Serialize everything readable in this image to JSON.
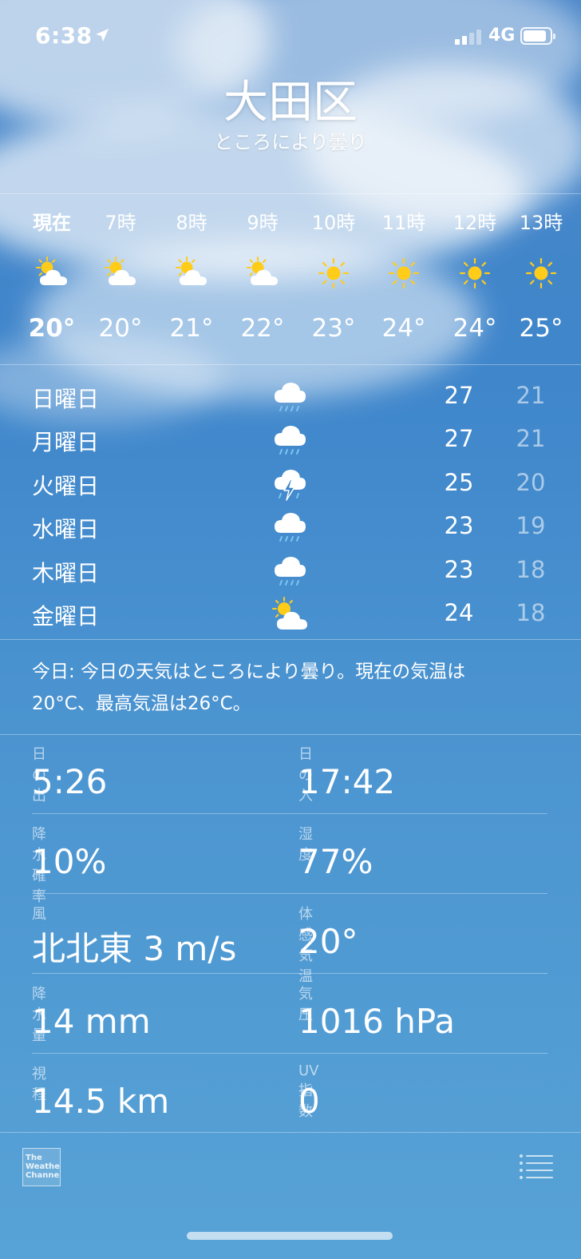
{
  "status_bar": {
    "time": "6:38",
    "network": "4G"
  },
  "header": {
    "city": "大田区",
    "condition": "ところにより曇り"
  },
  "hourly": [
    {
      "label": "現在",
      "icon": "partly-cloudy-icon",
      "temp": "20°"
    },
    {
      "label": "7時",
      "icon": "partly-cloudy-icon",
      "temp": "20°"
    },
    {
      "label": "8時",
      "icon": "partly-cloudy-icon",
      "temp": "21°"
    },
    {
      "label": "9時",
      "icon": "partly-cloudy-icon",
      "temp": "22°"
    },
    {
      "label": "10時",
      "icon": "sun-icon",
      "temp": "23°"
    },
    {
      "label": "11時",
      "icon": "sun-icon",
      "temp": "24°"
    },
    {
      "label": "12時",
      "icon": "sun-icon",
      "temp": "24°"
    },
    {
      "label": "13時",
      "icon": "sun-icon",
      "temp": "25°"
    }
  ],
  "daily": [
    {
      "day": "日曜日",
      "icon": "rain-icon",
      "high": "27",
      "low": "21"
    },
    {
      "day": "月曜日",
      "icon": "rain-icon",
      "high": "27",
      "low": "21"
    },
    {
      "day": "火曜日",
      "icon": "thunderstorm-icon",
      "high": "25",
      "low": "20"
    },
    {
      "day": "水曜日",
      "icon": "rain-icon",
      "high": "23",
      "low": "19"
    },
    {
      "day": "木曜日",
      "icon": "rain-icon",
      "high": "23",
      "low": "18"
    },
    {
      "day": "金曜日",
      "icon": "partly-cloudy-icon",
      "high": "24",
      "low": "18"
    }
  ],
  "summary": {
    "line1": "今日: 今日の天気はところにより曇り。現在の気温は",
    "line2": "20°C、最高気温は26°C。"
  },
  "details": [
    {
      "label": "日の出",
      "value": "5:26"
    },
    {
      "label": "日の入",
      "value": "17:42"
    },
    {
      "label": "降水確率",
      "value": "10%"
    },
    {
      "label": "湿度",
      "value": "77%"
    },
    {
      "label": "風",
      "value": "北北東 3 m/s"
    },
    {
      "label": "体感気温",
      "value": "20°"
    },
    {
      "label": "降水量",
      "value": "14 mm"
    },
    {
      "label": "気圧",
      "value": "1016 hPa"
    },
    {
      "label": "視程",
      "value": "14.5 km"
    },
    {
      "label": "UV指数",
      "value": "0"
    }
  ],
  "footer": {
    "logo_line1": "The",
    "logo_line2": "Weather",
    "logo_line3": "Channel"
  },
  "colors": {
    "sun": "#FFCC1A",
    "rain": "#7CC6F2",
    "cloud": "#FFFFFF",
    "sky": "#4A8FCF"
  }
}
